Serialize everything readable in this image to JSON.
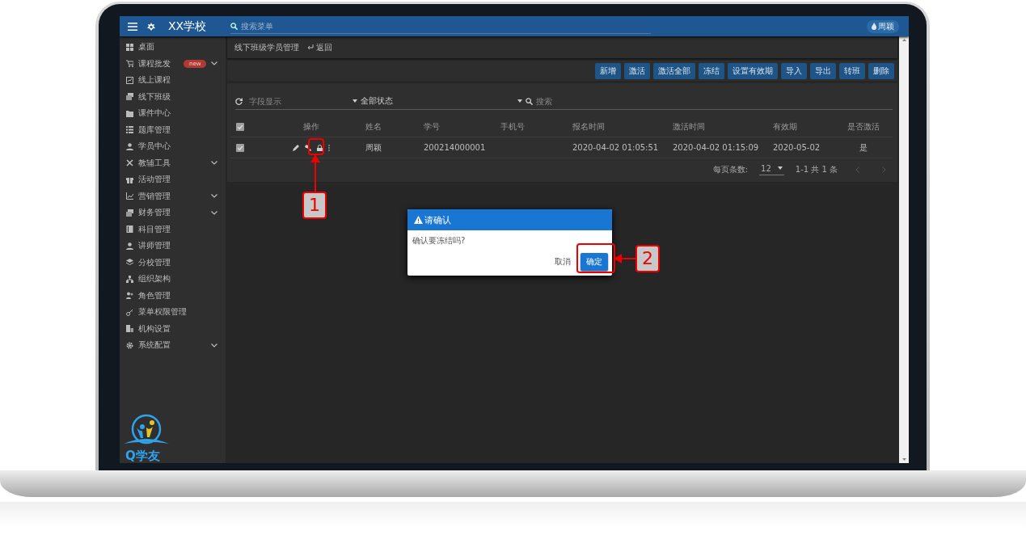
{
  "header": {
    "title": "XX学校",
    "search_placeholder": "搜索菜单",
    "user": "周颖"
  },
  "sidebar": {
    "items": [
      {
        "label": "桌面",
        "kind": "link"
      },
      {
        "label": "课程批发",
        "kind": "group",
        "expanded": false,
        "badge": "new"
      },
      {
        "label": "线上课程",
        "kind": "link"
      },
      {
        "label": "线下班级",
        "kind": "link"
      },
      {
        "label": "课件中心",
        "kind": "link"
      },
      {
        "label": "题库管理",
        "kind": "link"
      },
      {
        "label": "学员中心",
        "kind": "link"
      },
      {
        "label": "教辅工具",
        "kind": "group",
        "expanded": false
      },
      {
        "label": "活动管理",
        "kind": "link"
      },
      {
        "label": "营销管理",
        "kind": "group",
        "expanded": false
      },
      {
        "label": "财务管理",
        "kind": "group",
        "expanded": false
      },
      {
        "label": "科目管理",
        "kind": "link"
      },
      {
        "label": "讲师管理",
        "kind": "link"
      },
      {
        "label": "分校管理",
        "kind": "link"
      },
      {
        "label": "组织架构",
        "kind": "link"
      },
      {
        "label": "角色管理",
        "kind": "link"
      },
      {
        "label": "菜单权限管理",
        "kind": "link"
      },
      {
        "label": "机构设置",
        "kind": "link"
      },
      {
        "label": "系统配置",
        "kind": "group",
        "expanded": false
      }
    ],
    "logo_text": "Q学友"
  },
  "breadcrumb": {
    "title": "线下班级学员管理",
    "back": "返回"
  },
  "toolbar": {
    "buttons": [
      "新增",
      "激活",
      "激活全部",
      "冻结",
      "设置有效期",
      "导入",
      "导出",
      "转班",
      "删除"
    ]
  },
  "filters": {
    "fields_placeholder": "字段显示",
    "status": "全部状态",
    "search_placeholder": "搜索"
  },
  "table": {
    "header_checked": true,
    "columns": [
      "操作",
      "姓名",
      "学号",
      "手机号",
      "报名时间",
      "激活时间",
      "有效期",
      "是否激活"
    ],
    "rows": [
      {
        "checked": true,
        "cells": [
          "",
          "周颖",
          "200214000001",
          "",
          "2020-04-02 01:05:51",
          "2020-04-02 01:15:09",
          "2020-05-02",
          "是"
        ]
      }
    ]
  },
  "pagination": {
    "per_page_label": "每页条数:",
    "per_page": "12",
    "range": "1-1 共 1 条"
  },
  "dialog": {
    "title": "请确认",
    "message": "确认要冻结吗?",
    "buttons": [
      {
        "label": "取消",
        "kind": "text"
      },
      {
        "label": "确定",
        "kind": "primary"
      }
    ]
  },
  "annotations": [
    {
      "label": "1"
    },
    {
      "label": "2"
    }
  ]
}
